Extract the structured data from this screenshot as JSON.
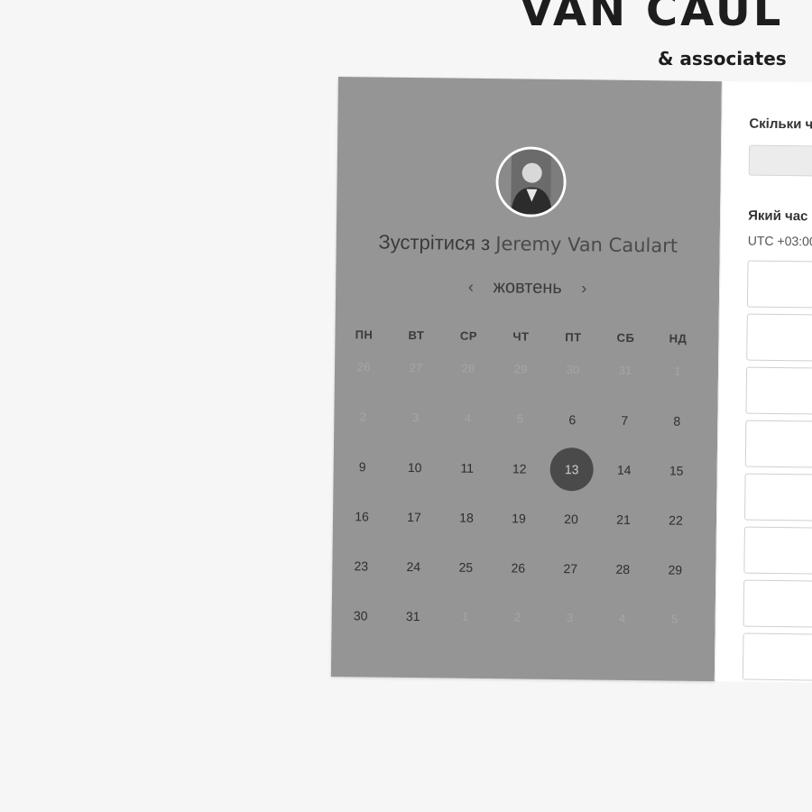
{
  "brand": {
    "name": "VAN CAUL",
    "tagline": "& associates"
  },
  "booking": {
    "title_prefix": "Зустрітися з",
    "host": "Jeremy Van Caulart",
    "month": "жовтень",
    "prev_icon": "chevron-left-icon",
    "next_icon": "chevron-right-icon",
    "prev_label": "‹",
    "next_label": "›",
    "weekdays": [
      "ПН",
      "ВТ",
      "СР",
      "ЧТ",
      "ПТ",
      "СБ",
      "НД"
    ],
    "weeks": [
      [
        "26",
        "27",
        "28",
        "29",
        "30",
        "31",
        "1"
      ],
      [
        "2",
        "3",
        "4",
        "5",
        "6",
        "7",
        "8"
      ],
      [
        "9",
        "10",
        "11",
        "12",
        "13",
        "14",
        "15"
      ],
      [
        "16",
        "17",
        "18",
        "19",
        "20",
        "21",
        "22"
      ],
      [
        "23",
        "24",
        "25",
        "26",
        "27",
        "28",
        "29"
      ],
      [
        "30",
        "31",
        "1",
        "2",
        "3",
        "4",
        "5"
      ]
    ],
    "muted_days": [
      [
        0,
        0
      ],
      [
        0,
        1
      ],
      [
        0,
        2
      ],
      [
        0,
        3
      ],
      [
        0,
        4
      ],
      [
        0,
        5
      ],
      [
        0,
        6
      ],
      [
        1,
        0
      ],
      [
        1,
        1
      ],
      [
        1,
        2
      ],
      [
        1,
        3
      ],
      [
        5,
        2
      ],
      [
        5,
        3
      ],
      [
        5,
        4
      ],
      [
        5,
        5
      ],
      [
        5,
        6
      ]
    ],
    "selected_day": "13"
  },
  "form": {
    "duration_question": "Скільки ч",
    "time_question": "Який час",
    "timezone": "UTC +03:00"
  },
  "colors": {
    "calendar_bg": "#959595",
    "selected_day_bg": "#4a4a4a",
    "page_bg": "#f6f6f6"
  }
}
